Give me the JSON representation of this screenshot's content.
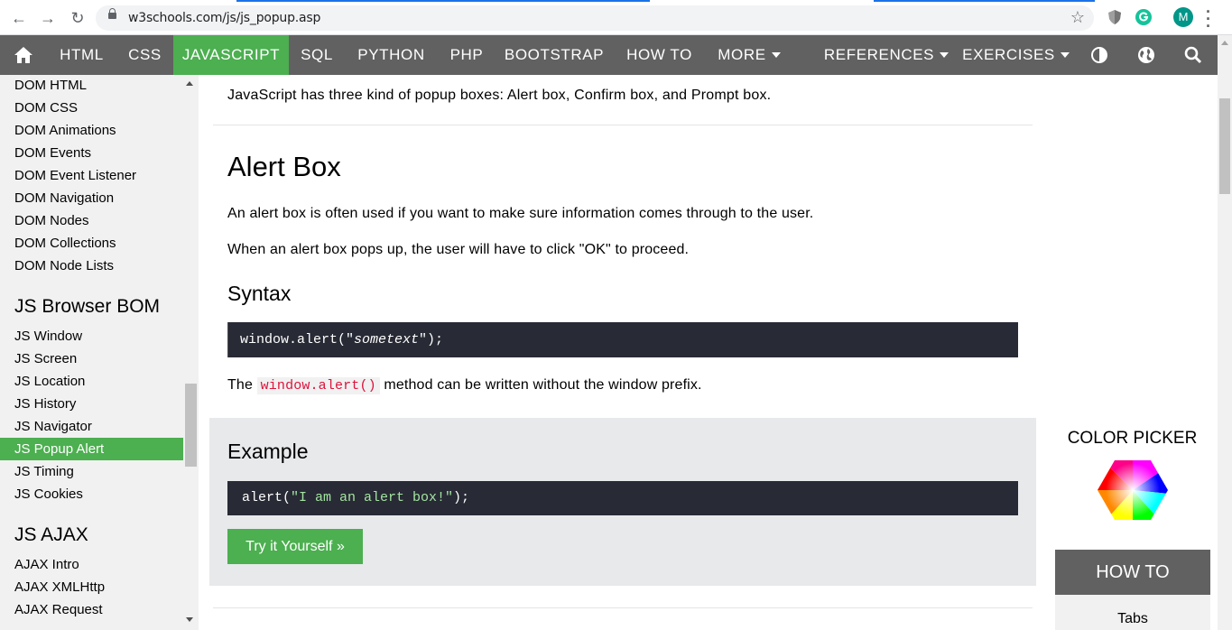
{
  "browser": {
    "url": "w3schools.com/js/js_popup.asp",
    "avatar_letter": "M",
    "back_icon": "←",
    "forward_icon": "→",
    "reload_icon": "↻",
    "star_icon": "☆"
  },
  "topnav": {
    "items": [
      {
        "label": "HTML"
      },
      {
        "label": "CSS"
      },
      {
        "label": "JAVASCRIPT"
      },
      {
        "label": "SQL"
      },
      {
        "label": "PYTHON"
      },
      {
        "label": "PHP"
      },
      {
        "label": "BOOTSTRAP"
      },
      {
        "label": "HOW TO"
      },
      {
        "label": "MORE"
      },
      {
        "label": "REFERENCES"
      },
      {
        "label": "EXERCISES"
      }
    ],
    "active_index": 2,
    "accent_color": "#4caf50"
  },
  "sidebar": {
    "dom_links": [
      "DOM HTML",
      "DOM CSS",
      "DOM Animations",
      "DOM Events",
      "DOM Event Listener",
      "DOM Navigation",
      "DOM Nodes",
      "DOM Collections",
      "DOM Node Lists"
    ],
    "bom_heading": "JS Browser BOM",
    "bom_links": [
      "JS Window",
      "JS Screen",
      "JS Location",
      "JS History",
      "JS Navigator",
      "JS Popup Alert",
      "JS Timing",
      "JS Cookies"
    ],
    "ajax_heading": "JS AJAX",
    "ajax_links": [
      "AJAX Intro",
      "AJAX XMLHttp",
      "AJAX Request"
    ],
    "active_link": "JS Popup Alert"
  },
  "main": {
    "intro": "JavaScript has three kind of popup boxes: Alert box, Confirm box, and Prompt box.",
    "alert_title": "Alert Box",
    "alert_p1": "An alert box is often used if you want to make sure information comes through to the user.",
    "alert_p2": "When an alert box pops up, the user will have to click \"OK\" to proceed.",
    "syntax_title": "Syntax",
    "syntax_code": {
      "prefix": "window.alert(\"",
      "italic": "sometext",
      "suffix": "\");"
    },
    "method_note": {
      "before": "The ",
      "code": "window.alert()",
      "after": " method can be written without the window prefix."
    },
    "example_title": "Example",
    "example_code": {
      "prefix": "alert(",
      "string": "\"I am an alert box!\"",
      "suffix": ");"
    },
    "try_button": "Try it Yourself »"
  },
  "right": {
    "color_picker_label": "COLOR PICKER",
    "howto_label": "HOW TO",
    "howto_first_item": "Tabs"
  }
}
